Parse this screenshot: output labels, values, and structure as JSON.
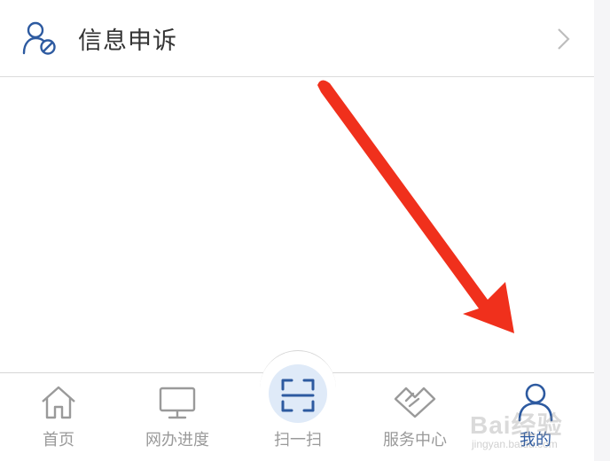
{
  "list_row": {
    "label": "信息申诉",
    "icon": "user-block-icon",
    "chevron": "chevron-right-icon"
  },
  "tab_bar": {
    "items": [
      {
        "label": "首页",
        "icon": "home-icon",
        "active": false
      },
      {
        "label": "网办进度",
        "icon": "monitor-icon",
        "active": false
      },
      {
        "label": "扫一扫",
        "icon": "scan-icon",
        "active": false
      },
      {
        "label": "服务中心",
        "icon": "handshake-icon",
        "active": false
      },
      {
        "label": "我的",
        "icon": "user-icon",
        "active": true
      }
    ]
  },
  "annotation": {
    "type": "red-arrow",
    "color": "#f0301c",
    "points_to": "我的"
  },
  "watermark": {
    "text": "Bai经验",
    "url": "jingyan.baidu.com"
  },
  "colors": {
    "accent": "#2d5aa0",
    "inactive": "#9a9a9a",
    "row_text": "#333333",
    "arrow": "#f0301c",
    "scan_bg": "#dfeaf8"
  }
}
